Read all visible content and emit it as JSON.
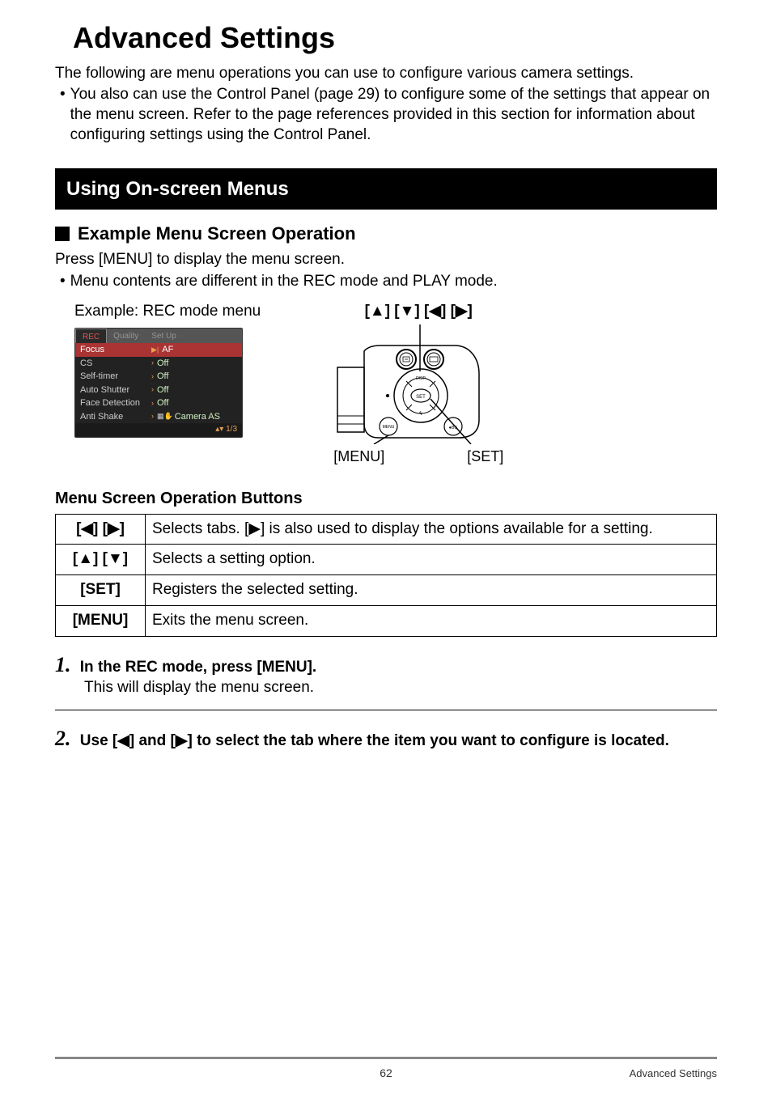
{
  "title": "Advanced Settings",
  "intro_line": "The following are menu operations you can use to configure various camera settings.",
  "intro_bullet": "You also can use the Control Panel (page 29) to configure some of the settings that appear on the menu screen. Refer to the page references provided in this section for information about configuring settings using the Control Panel.",
  "section_header": "Using On-screen Menus",
  "subheading": "Example Menu Screen Operation",
  "press_menu": "Press [MENU] to display the menu screen.",
  "rec_play_note": "Menu contents are different in the REC mode and PLAY mode.",
  "example_caption": "Example: REC mode menu",
  "diagram_arrows": "[▲] [▼] [◀] [▶]",
  "diagram_menu_label": "[MENU]",
  "diagram_set_label": "[SET]",
  "camera_menu": {
    "tabs": [
      "REC",
      "Quality",
      "Set Up"
    ],
    "items": [
      {
        "label": "Focus",
        "value": "AF",
        "selected": true,
        "icon": "▶|"
      },
      {
        "label": "CS",
        "value": "Off"
      },
      {
        "label": "Self-timer",
        "value": "Off"
      },
      {
        "label": "Auto Shutter",
        "value": "Off"
      },
      {
        "label": "Face Detection",
        "value": "Off"
      },
      {
        "label": "Anti Shake",
        "value": "Camera AS",
        "icon": "▦✋"
      }
    ],
    "page_indicator": "▴▾ 1/3"
  },
  "ops_heading": "Menu Screen Operation Buttons",
  "ops_table": [
    {
      "button": "[◀] [▶]",
      "desc": "Selects tabs. [▶] is also used to display the options available for a setting."
    },
    {
      "button": "[▲] [▼]",
      "desc": "Selects a setting option."
    },
    {
      "button": "[SET]",
      "desc": "Registers the selected setting."
    },
    {
      "button": "[MENU]",
      "desc": "Exits the menu screen."
    }
  ],
  "steps": [
    {
      "num": "1.",
      "title": "In the REC mode, press [MENU].",
      "body": "This will display the menu screen."
    },
    {
      "num": "2.",
      "title": "Use [◀] and [▶] to select the tab where the item you want to configure is located."
    }
  ],
  "footer": {
    "page_num": "62",
    "title": "Advanced Settings"
  }
}
